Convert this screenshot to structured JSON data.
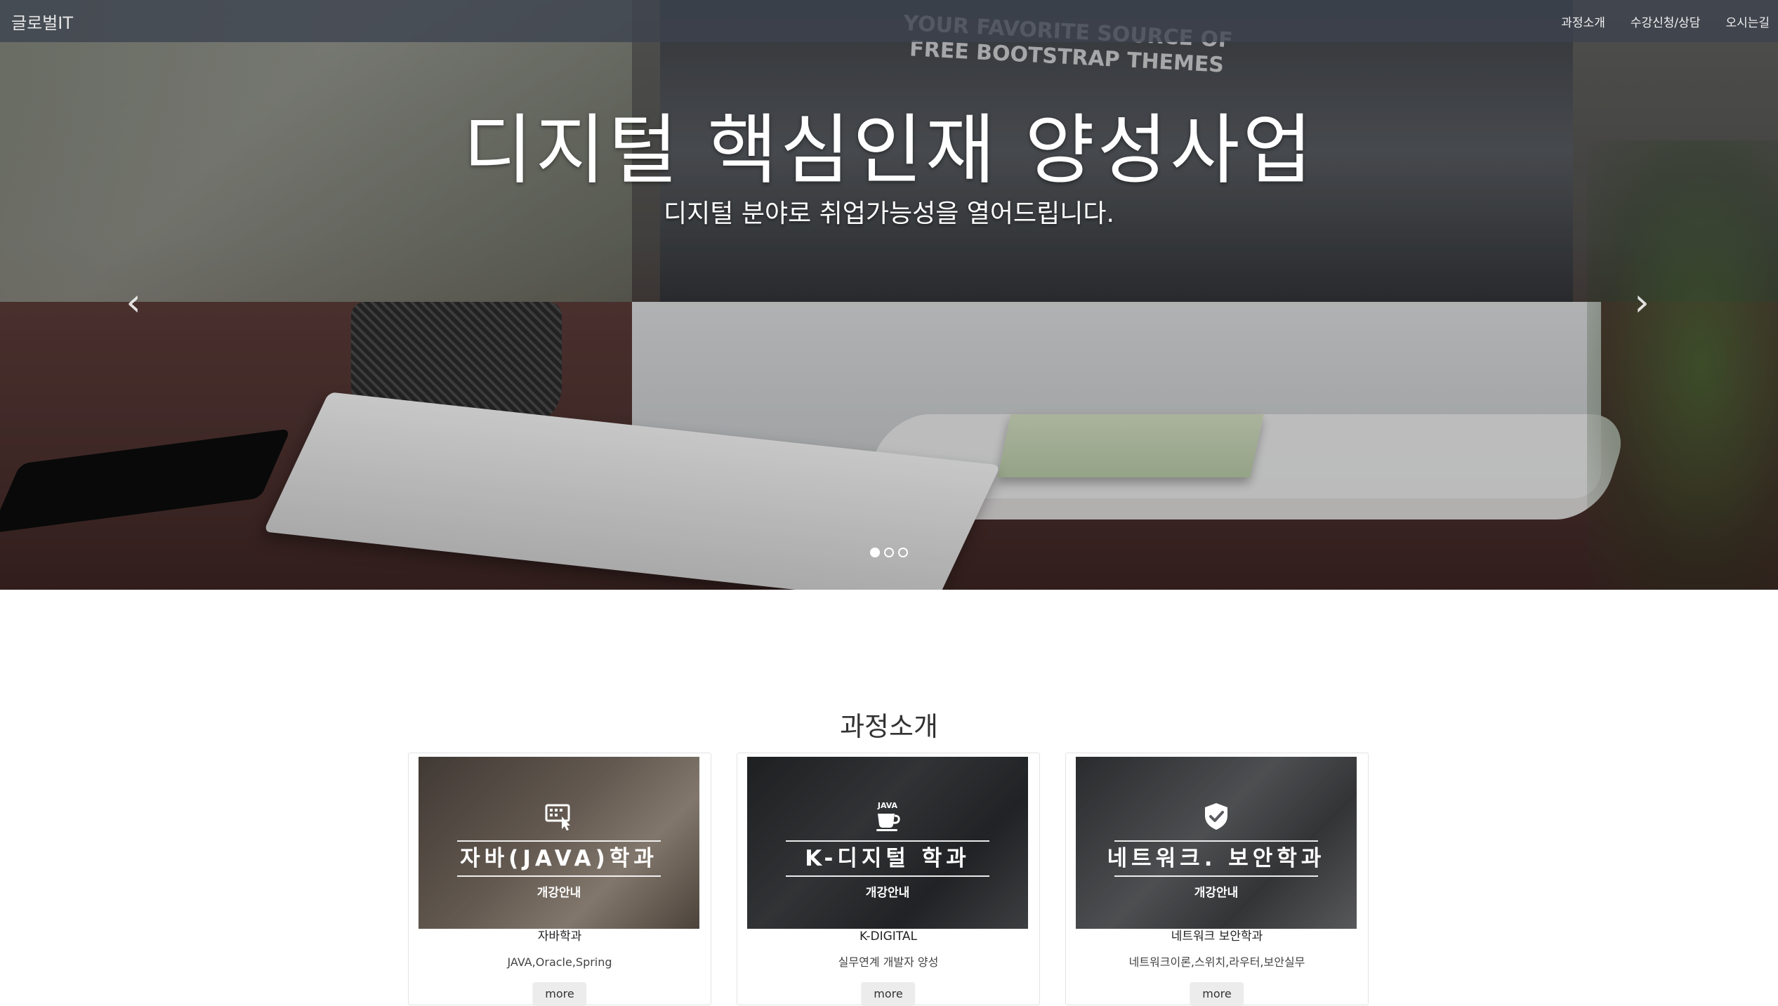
{
  "navbar": {
    "brand": "글로벌IT",
    "links": [
      "과정소개",
      "수강신청/상담",
      "오시는길"
    ]
  },
  "hero": {
    "screen_text": "YOUR FAVORITE SOURCE OF FREE BOOTSTRAP THEMES",
    "title": "디지털 핵심인재 양성사업",
    "subtitle": "디지털 분야로 취업가능성을 열어드립니다.",
    "prev_icon": "chevron-left-icon",
    "next_icon": "chevron-right-icon",
    "prev_glyph": "‹",
    "next_glyph": "›",
    "slides_total": 3,
    "active_slide": 1
  },
  "courses": {
    "title": "과정소개",
    "cards": [
      {
        "icon": "touch-screen-icon",
        "thumb_title": "자바(JAVA)학과",
        "thumb_sub": "개강안내",
        "name": "자바학과",
        "desc": "JAVA,Oracle,Spring",
        "more": "more"
      },
      {
        "icon": "java-coffee-icon",
        "icon_text": "JAVA",
        "thumb_title": "K-디지털 학과",
        "thumb_sub": "개강안내",
        "name": "K-DIGITAL",
        "desc": "실무연계 개발자 양성",
        "more": "more"
      },
      {
        "icon": "shield-check-icon",
        "thumb_title": "네트워크. 보안학과",
        "thumb_sub": "개강안내",
        "name": "네트워크 보안학과",
        "desc": "네트워크이론,스위치,라우터,보안실무",
        "more": "more"
      }
    ]
  },
  "colors": {
    "navbar_bg": "#3c424e",
    "text_dark": "#333333",
    "button_bg": "#ececec"
  }
}
